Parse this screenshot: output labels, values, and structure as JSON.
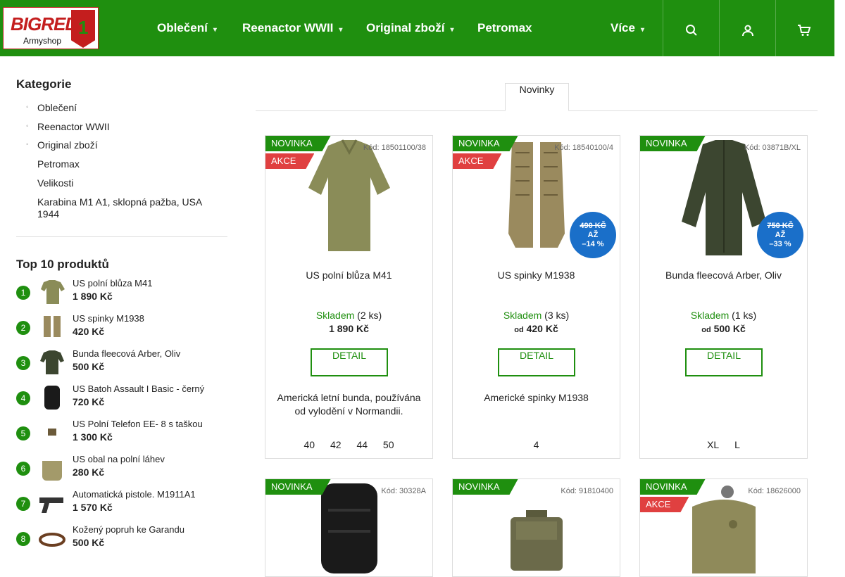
{
  "logo": {
    "brand": "BIGRED",
    "number": "1",
    "sub": "Armyshop"
  },
  "nav": {
    "items": [
      {
        "label": "Oblečení",
        "caret": "▾"
      },
      {
        "label": "Reenactor WWII",
        "caret": "▾"
      },
      {
        "label": "Original zboží",
        "caret": "▾"
      },
      {
        "label": "Petromax",
        "caret": ""
      },
      {
        "label": "Více",
        "caret": "▾"
      }
    ],
    "icons": [
      "search-icon",
      "user-icon",
      "cart-icon"
    ]
  },
  "sidebar": {
    "categories_title": "Kategorie",
    "categories": [
      {
        "label": "Oblečení",
        "bullet": "◦"
      },
      {
        "label": "Reenactor WWII",
        "bullet": "◦"
      },
      {
        "label": "Original zboží",
        "bullet": "◦"
      },
      {
        "label": "Petromax",
        "bullet": ""
      },
      {
        "label": "Velikosti",
        "bullet": ""
      },
      {
        "label": "Karabina M1 A1, sklopná pažba, USA 1944",
        "bullet": ""
      }
    ],
    "top_title": "Top 10 produktů",
    "top": [
      {
        "rank": "1",
        "name": "US polní blůza M41",
        "price": "1 890 Kč"
      },
      {
        "rank": "2",
        "name": "US spinky M1938",
        "price": "420 Kč"
      },
      {
        "rank": "3",
        "name": "Bunda fleecová Arber, Oliv",
        "price": "500 Kč"
      },
      {
        "rank": "4",
        "name": "US Batoh Assault I Basic - černý",
        "price": "720 Kč"
      },
      {
        "rank": "5",
        "name": "US Polní Telefon EE- 8 s taškou",
        "price": "1 300 Kč"
      },
      {
        "rank": "6",
        "name": "US obal na polní láhev",
        "price": "280 Kč"
      },
      {
        "rank": "7",
        "name": "Automatická pistole. M1911A1",
        "price": "1 570 Kč"
      },
      {
        "rank": "8",
        "name": "Kožený popruh ke Garandu",
        "price": "500 Kč"
      }
    ]
  },
  "tabs": {
    "active": "Novinky"
  },
  "products": [
    {
      "flag_new": "NOVINKA",
      "flag_sale": "AKCE",
      "code": "Kód: 18501100/38",
      "name": "US polní blůza M41",
      "stock_label": "Skladem",
      "stock_qty": "(2 ks)",
      "price_prefix": "",
      "price": "1 890 Kč",
      "detail": "DETAIL",
      "desc": "Americká letní bunda, používána od vylodění v Normandii.",
      "sizes": [
        "40",
        "42",
        "44",
        "50"
      ],
      "badge": null,
      "color": "#8a8c58"
    },
    {
      "flag_new": "NOVINKA",
      "flag_sale": "AKCE",
      "code": "Kód: 18540100/4",
      "name": "US spinky M1938",
      "stock_label": "Skladem",
      "stock_qty": "(3 ks)",
      "price_prefix": "od",
      "price": "420 Kč",
      "detail": "DETAIL",
      "desc": "Americké spinky M1938",
      "sizes": [
        "4"
      ],
      "badge": {
        "old": "490 KČ",
        "mid": "AŽ",
        "pct": "–14 %"
      },
      "color": "#9a8a5e"
    },
    {
      "flag_new": "NOVINKA",
      "flag_sale": "",
      "code": "Kód: 03871B/XL",
      "name": "Bunda fleecová Arber, Oliv",
      "stock_label": "Skladem",
      "stock_qty": "(1 ks)",
      "price_prefix": "od",
      "price": "500 Kč",
      "detail": "DETAIL",
      "desc": "",
      "sizes": [
        "XL",
        "L"
      ],
      "badge": {
        "old": "750 KČ",
        "mid": "AŽ",
        "pct": "–33 %"
      },
      "color": "#3c4630"
    },
    {
      "flag_new": "NOVINKA",
      "flag_sale": "",
      "code": "Kód: 30328A",
      "color": "#1a1a1a"
    },
    {
      "flag_new": "NOVINKA",
      "flag_sale": "",
      "code": "Kód: 91810400",
      "color": "#6b6a4a"
    },
    {
      "flag_new": "NOVINKA",
      "flag_sale": "AKCE",
      "code": "Kód: 18626000",
      "color": "#8f8a5a"
    }
  ]
}
